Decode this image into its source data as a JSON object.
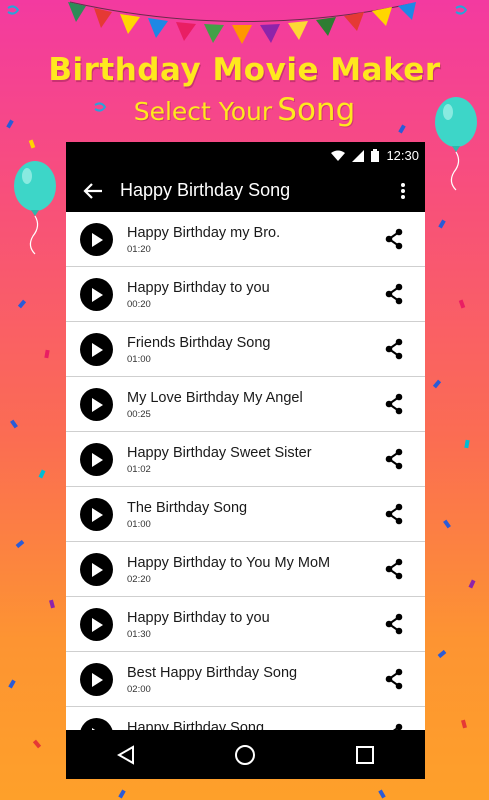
{
  "promo": {
    "title": "Birthday Movie Maker",
    "subtitle_prefix": "Select Your",
    "subtitle_highlight": "Song"
  },
  "status_bar": {
    "time": "12:30"
  },
  "app_bar": {
    "title": "Happy Birthday Song"
  },
  "songs": [
    {
      "title": "Happy Birthday my Bro.",
      "duration": "01:20"
    },
    {
      "title": "Happy Birthday to you",
      "duration": "00:20"
    },
    {
      "title": "Friends Birthday Song",
      "duration": "01:00"
    },
    {
      "title": "My Love Birthday My Angel",
      "duration": "00:25"
    },
    {
      "title": "Happy Birthday Sweet Sister",
      "duration": "01:02"
    },
    {
      "title": "The Birthday Song",
      "duration": "01:00"
    },
    {
      "title": "Happy Birthday to You My MoM",
      "duration": "02:20"
    },
    {
      "title": "Happy Birthday to you",
      "duration": "01:30"
    },
    {
      "title": "Best Happy Birthday Song",
      "duration": "02:00"
    },
    {
      "title": "Happy Birthday Song",
      "duration": ""
    }
  ],
  "colors": {
    "accent_yellow": "#ffe81e",
    "balloon": "#3dd6c8",
    "bar_black": "#000000"
  }
}
